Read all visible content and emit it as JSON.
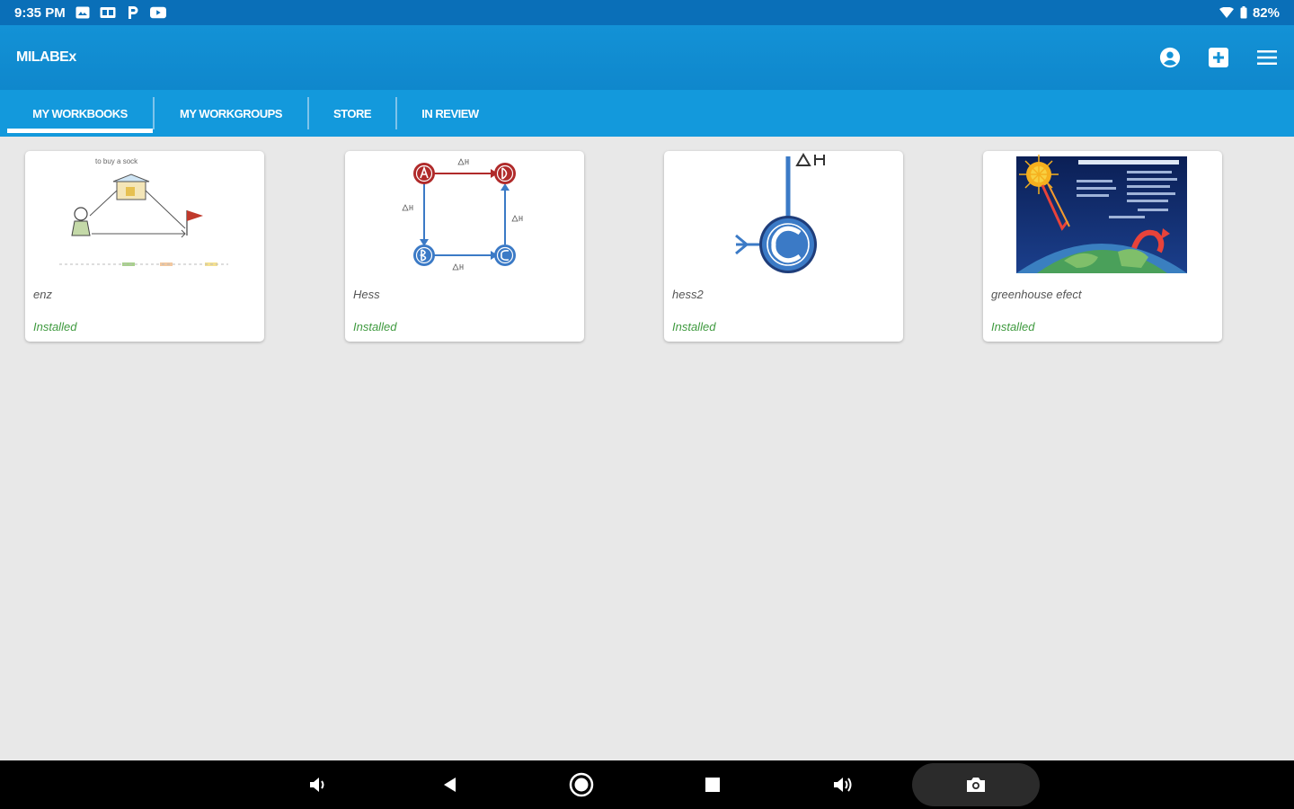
{
  "status_bar": {
    "time": "9:35 PM",
    "battery": "82%",
    "icons": [
      "image-icon",
      "picture-icon",
      "parking-icon",
      "youtube-icon",
      "wifi-icon",
      "battery-icon"
    ]
  },
  "app_bar": {
    "title": "MILABEx",
    "actions": [
      "account-icon",
      "add-icon",
      "menu-icon"
    ]
  },
  "tabs": [
    {
      "label": "MY WORKBOOKS",
      "active": true
    },
    {
      "label": "MY WORKGROUPS",
      "active": false
    },
    {
      "label": "STORE",
      "active": false
    },
    {
      "label": "IN REVIEW",
      "active": false
    }
  ],
  "workbooks": [
    {
      "title": "enz",
      "status": "Installed",
      "thumb_caption": "to buy a sock"
    },
    {
      "title": "Hess",
      "status": "Installed"
    },
    {
      "title": "hess2",
      "status": "Installed"
    },
    {
      "title": "greenhouse efect",
      "status": "Installed"
    }
  ],
  "colors": {
    "status_bar": "#0a6fb8",
    "app_bar": "#1392d6",
    "tab_bar": "#1399dc",
    "installed_text": "#3f9a3f",
    "background": "#e8e8e8",
    "hess_red": "#b02a2a",
    "hess_blue": "#3b7ac6"
  },
  "nav_bar": {
    "buttons": [
      "volume-down-icon",
      "back-icon",
      "home-icon",
      "recents-icon",
      "volume-up-icon",
      "screenshot-icon"
    ]
  }
}
